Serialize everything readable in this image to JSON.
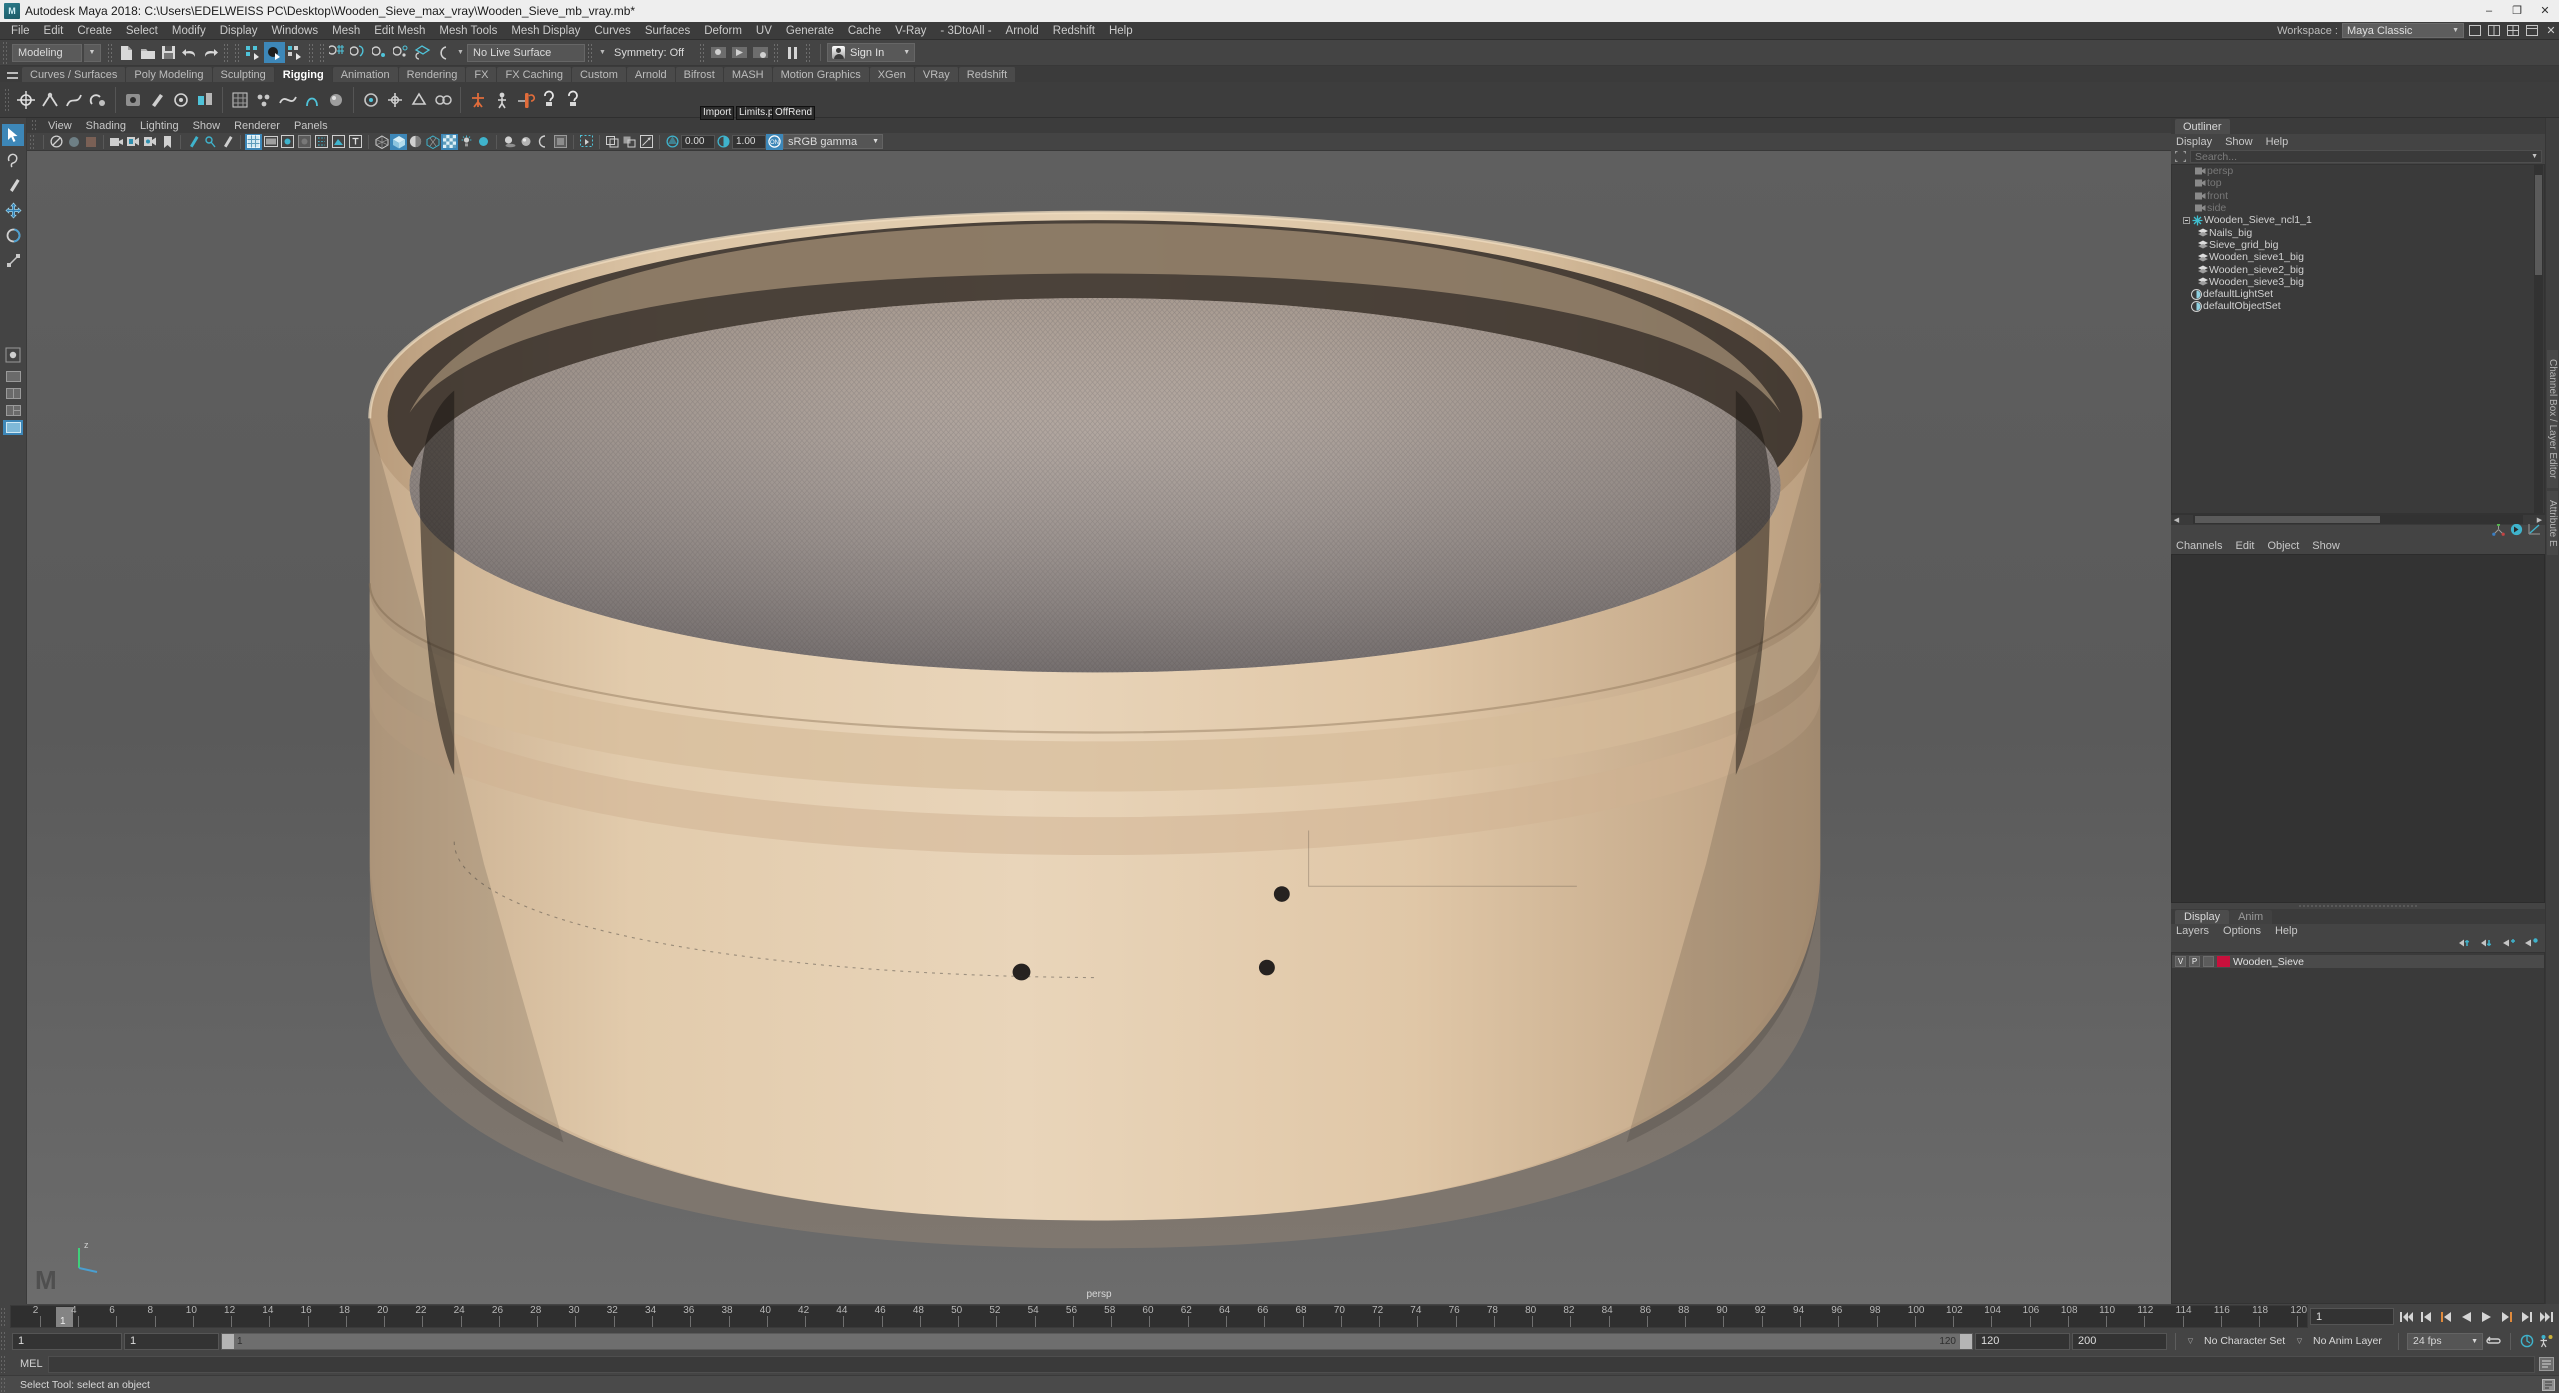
{
  "window": {
    "title": "Autodesk Maya 2018: C:\\Users\\EDELWEISS PC\\Desktop\\Wooden_Sieve_max_vray\\Wooden_Sieve_mb_vray.mb*",
    "logo": "maya-logo",
    "minimize": "–",
    "maximize": "❐",
    "close": "✕"
  },
  "menubar": {
    "items": [
      "File",
      "Edit",
      "Create",
      "Select",
      "Modify",
      "Display",
      "Windows",
      "Mesh",
      "Edit Mesh",
      "Mesh Tools",
      "Mesh Display",
      "Curves",
      "Surfaces",
      "Deform",
      "UV",
      "Generate",
      "Cache",
      "V-Ray",
      "- 3DtoAll -",
      "Arnold",
      "Redshift",
      "Help"
    ],
    "workspace_label": "Workspace :",
    "workspace_value": "Maya Classic"
  },
  "toolbar": {
    "mode": "Modeling",
    "live_surface": "No Live Surface",
    "symmetry": "Symmetry: Off",
    "signin": "Sign In"
  },
  "shelf": {
    "tabs": [
      {
        "label": "Curves / Surfaces",
        "active": false
      },
      {
        "label": "Poly Modeling",
        "active": false
      },
      {
        "label": "Sculpting",
        "active": false
      },
      {
        "label": "Rigging",
        "active": true
      },
      {
        "label": "Animation",
        "active": false
      },
      {
        "label": "Rendering",
        "active": false
      },
      {
        "label": "FX",
        "active": false
      },
      {
        "label": "FX Caching",
        "active": false
      },
      {
        "label": "Custom",
        "active": false
      },
      {
        "label": "Arnold",
        "active": false
      },
      {
        "label": "Bifrost",
        "active": false
      },
      {
        "label": "MASH",
        "active": false
      },
      {
        "label": "Motion Graphics",
        "active": false
      },
      {
        "label": "XGen",
        "active": false
      },
      {
        "label": "VRay",
        "active": false
      },
      {
        "label": "Redshift",
        "active": false
      }
    ],
    "tooltips": [
      "Import",
      "Limits.p",
      "OffRend"
    ]
  },
  "viewport_panel": {
    "menus": [
      "View",
      "Shading",
      "Lighting",
      "Show",
      "Renderer",
      "Panels"
    ],
    "exposure": "0.00",
    "gamma_value": "1.00",
    "color_profile": "sRGB gamma",
    "camera_label": "persp",
    "axis_label": "z"
  },
  "outliner": {
    "tab": "Outliner",
    "menus": [
      "Display",
      "Show",
      "Help"
    ],
    "search_placeholder": "Search...",
    "items": [
      {
        "label": "persp",
        "icon": "camera-icon",
        "dim": true,
        "indent": 1
      },
      {
        "label": "top",
        "icon": "camera-icon",
        "dim": true,
        "indent": 1
      },
      {
        "label": "front",
        "icon": "camera-icon",
        "dim": true,
        "indent": 1
      },
      {
        "label": "side",
        "icon": "camera-icon",
        "dim": true,
        "indent": 1
      },
      {
        "label": "Wooden_Sieve_ncl1_1",
        "icon": "group-star-icon",
        "dim": false,
        "indent": 0
      },
      {
        "label": "Nails_big",
        "icon": "mesh-icon",
        "dim": false,
        "indent": 2
      },
      {
        "label": "Sieve_grid_big",
        "icon": "mesh-icon",
        "dim": false,
        "indent": 2
      },
      {
        "label": "Wooden_sieve1_big",
        "icon": "mesh-icon",
        "dim": false,
        "indent": 2
      },
      {
        "label": "Wooden_sieve2_big",
        "icon": "mesh-icon",
        "dim": false,
        "indent": 2
      },
      {
        "label": "Wooden_sieve3_big",
        "icon": "mesh-icon",
        "dim": false,
        "indent": 2
      },
      {
        "label": "defaultLightSet",
        "icon": "set-icon",
        "dim": false,
        "indent": 1
      },
      {
        "label": "defaultObjectSet",
        "icon": "set-icon",
        "dim": false,
        "indent": 1
      }
    ]
  },
  "channelbox": {
    "menus": [
      "Channels",
      "Edit",
      "Object",
      "Show"
    ],
    "side_tab": "Channel Box / Layer Editor",
    "attr_tab": "Attribute E"
  },
  "layereditor": {
    "tabs": [
      {
        "label": "Display",
        "active": true
      },
      {
        "label": "Anim",
        "active": false
      }
    ],
    "menus": [
      "Layers",
      "Options",
      "Help"
    ],
    "layers": [
      {
        "visible": "V",
        "playback": "P",
        "color": "#c8103c",
        "name": "Wooden_Sieve"
      }
    ]
  },
  "timeslider": {
    "current_frame": "1",
    "start_display": "1",
    "ticks": [
      2,
      4,
      6,
      8,
      10,
      12,
      14,
      16,
      18,
      20,
      22,
      24,
      26,
      28,
      30,
      32,
      34,
      36,
      38,
      40,
      42,
      44,
      46,
      48,
      50,
      52,
      54,
      56,
      58,
      60,
      62,
      64,
      66,
      68,
      70,
      72,
      74,
      76,
      78,
      80,
      82,
      84,
      86,
      88,
      90,
      92,
      94,
      96,
      98,
      100,
      102,
      104,
      106,
      108,
      110,
      112,
      114,
      116,
      118,
      120
    ],
    "playback_buttons": [
      "go-to-start-icon",
      "step-back-key-icon",
      "step-back-frame-icon",
      "play-backwards-icon",
      "play-forwards-icon",
      "step-forward-frame-icon",
      "step-forward-key-icon",
      "go-to-end-icon"
    ]
  },
  "rangeslider": {
    "anim_start": "1",
    "range_start": "1",
    "range_bar_start": "1",
    "range_bar_end": "120",
    "range_end": "120",
    "anim_end": "200",
    "character_set": "No Character Set",
    "anim_layer": "No Anim Layer",
    "fps": "24 fps"
  },
  "commandline": {
    "language": "MEL",
    "input_value": ""
  },
  "statusbar": {
    "message": "Select Tool: select an object"
  }
}
